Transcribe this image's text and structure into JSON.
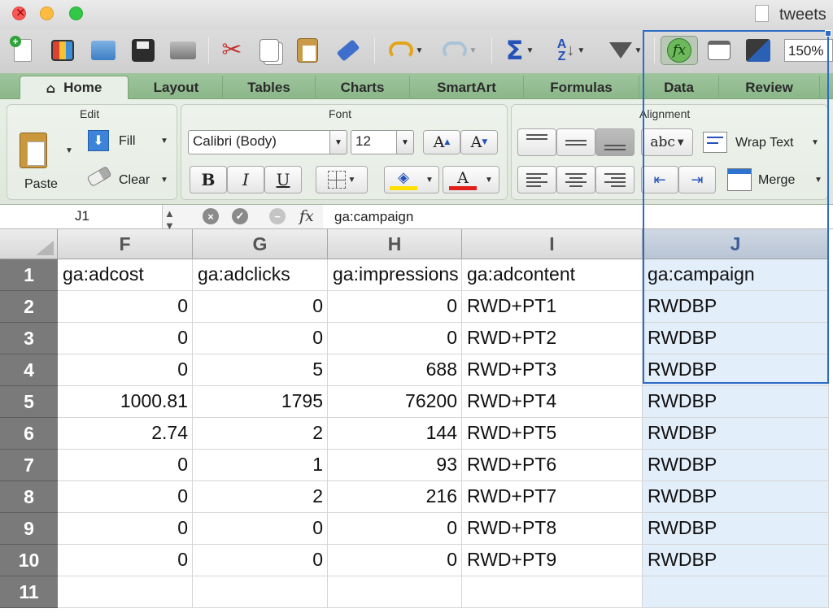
{
  "window": {
    "title": "tweets"
  },
  "toolbar": {
    "zoom": "150%"
  },
  "tabs": [
    "Home",
    "Layout",
    "Tables",
    "Charts",
    "SmartArt",
    "Formulas",
    "Data",
    "Review"
  ],
  "ribbon": {
    "edit": {
      "title": "Edit",
      "paste": "Paste",
      "fill": "Fill",
      "clear": "Clear"
    },
    "font": {
      "title": "Font",
      "name": "Calibri (Body)",
      "size": "12",
      "bold": "B",
      "italic": "I",
      "underline": "U",
      "grow": "A",
      "shrink": "A",
      "color_glyph": "A",
      "fill_color": "#ffe000",
      "font_color": "#e0211b"
    },
    "alignment": {
      "title": "Alignment",
      "wrap_text": "Wrap Text",
      "merge": "Merge",
      "abc": "abc"
    }
  },
  "formula_bar": {
    "cell_ref": "J1",
    "fx": "fx",
    "content": "ga:campaign"
  },
  "sheet": {
    "columns": [
      "F",
      "G",
      "H",
      "I",
      "J"
    ],
    "selected_column": "J",
    "row_numbers": [
      "1",
      "2",
      "3",
      "4",
      "5",
      "6",
      "7",
      "8",
      "9",
      "10",
      "11"
    ],
    "rows": [
      [
        "ga:adcost",
        "ga:adclicks",
        "ga:impressions",
        "ga:adcontent",
        "ga:campaign"
      ],
      [
        "0",
        "0",
        "0",
        "RWD+PT1",
        "RWDBP"
      ],
      [
        "0",
        "0",
        "0",
        "RWD+PT2",
        "RWDBP"
      ],
      [
        "0",
        "5",
        "688",
        "RWD+PT3",
        "RWDBP"
      ],
      [
        "1000.81",
        "1795",
        "76200",
        "RWD+PT4",
        "RWDBP"
      ],
      [
        "2.74",
        "2",
        "144",
        "RWD+PT5",
        "RWDBP"
      ],
      [
        "0",
        "1",
        "93",
        "RWD+PT6",
        "RWDBP"
      ],
      [
        "0",
        "2",
        "216",
        "RWD+PT7",
        "RWDBP"
      ],
      [
        "0",
        "0",
        "0",
        "RWD+PT8",
        "RWDBP"
      ],
      [
        "0",
        "0",
        "0",
        "RWD+PT9",
        "RWDBP"
      ],
      [
        "",
        "",
        "",
        "",
        ""
      ]
    ]
  }
}
